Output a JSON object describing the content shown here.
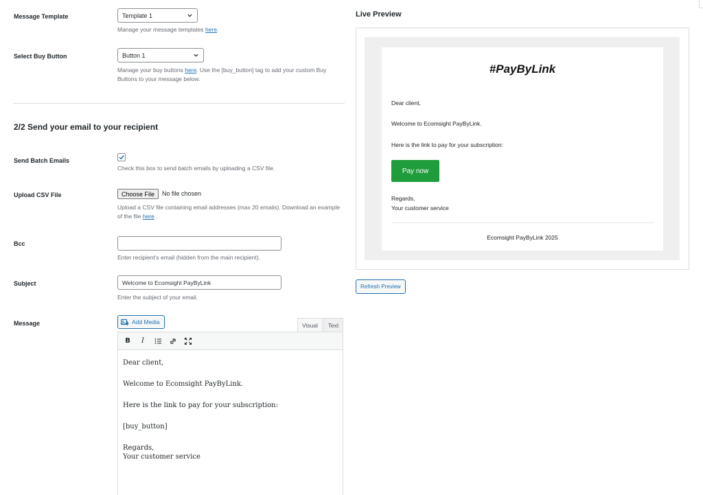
{
  "form": {
    "message_template": {
      "label": "Message Template",
      "selected": "Template 1",
      "description_prefix": "Manage your message templates ",
      "link": "here",
      "description_suffix": "."
    },
    "buy_button": {
      "label": "Select Buy Button",
      "selected": "Button 1",
      "description_prefix": "Manage your buy buttons ",
      "link": "here",
      "description_suffix": ". Use the [buy_button] tag to add your custom Buy Buttons to your message below."
    },
    "section_title": "2/2 Send your email to your recipient",
    "batch": {
      "label": "Send Batch Emails",
      "checked": true,
      "description": "Check this box to send batch emails by uploading a CSV file."
    },
    "csv": {
      "label": "Upload CSV File",
      "button": "Choose File",
      "status": "No file chosen",
      "description_prefix": "Upload a CSV file containing email addresses (max 20 emails). Download an example of the file ",
      "link": "here",
      "description_suffix": " ."
    },
    "bcc": {
      "label": "Bcc",
      "value": "",
      "description": "Enter recipient's email (hidden from the main recipient)."
    },
    "subject": {
      "label": "Subject",
      "value": "Welcome to Ecomsight PayByLink",
      "description": "Enter the subject of your email."
    },
    "message": {
      "label": "Message",
      "add_media": "Add Media",
      "tabs": [
        "Visual",
        "Text"
      ],
      "toolbar": {
        "bold": "B",
        "italic": "I",
        "list_icon": "bulleted-list-icon",
        "link_icon": "link-icon",
        "fullscreen_icon": "fullscreen-icon"
      },
      "content": {
        "greeting": "Dear client,",
        "welcome": "Welcome to Ecomsight PayByLink.",
        "link_line": "Here is the link to pay for your subscription:",
        "button_tag": "[buy_button]",
        "regards": "Regards,",
        "signature": "Your customer service"
      }
    }
  },
  "preview": {
    "title": "Live Preview",
    "brand": "#PayByLink",
    "greeting": "Dear client,",
    "welcome": "Welcome to Ecomsight PayByLink.",
    "link_line": "Here is the link to pay for your subscription:",
    "pay_button": "Pay now",
    "regards": "Regards,",
    "signature": "Your customer service",
    "footer": "Ecomsight PayByLink 2025",
    "refresh_button": "Refresh Preview"
  },
  "colors": {
    "link": "#2271b1",
    "pay_button": "#1f9d3c",
    "preview_background": "#efefef"
  }
}
